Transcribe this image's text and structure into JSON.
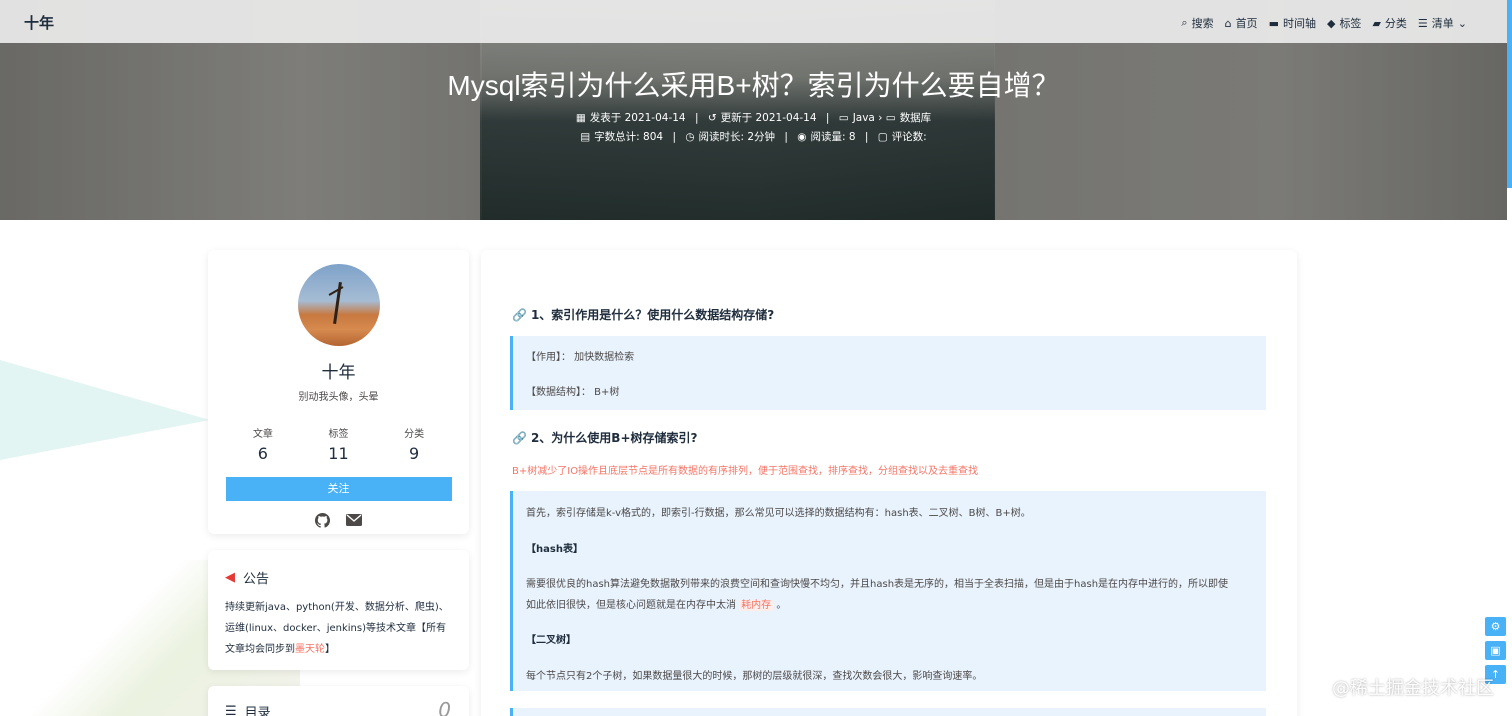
{
  "nav": {
    "site_name": "十年",
    "items": [
      {
        "label": "搜索",
        "icon": "search-icon"
      },
      {
        "label": "首页",
        "icon": "home-icon"
      },
      {
        "label": "时间轴",
        "icon": "archive-icon"
      },
      {
        "label": "标签",
        "icon": "tags-icon"
      },
      {
        "label": "分类",
        "icon": "folder-icon"
      },
      {
        "label": "清单",
        "icon": "list-icon"
      }
    ]
  },
  "post": {
    "title": "Mysql索引为什么采用B+树？索引为什么要自增？",
    "published_label": "发表于",
    "published": "2021-04-14",
    "updated_label": "更新于",
    "updated": "2021-04-14",
    "category1": "Java",
    "category2": "数据库",
    "wordcount": "字数总计: 804",
    "readtime": "阅读时长: 2分钟",
    "views": "阅读量: 8",
    "comments": "评论数:"
  },
  "profile": {
    "name": "十年",
    "motto": "别动我头像，头晕",
    "stats": [
      {
        "label": "文章",
        "value": "6"
      },
      {
        "label": "标签",
        "value": "11"
      },
      {
        "label": "分类",
        "value": "9"
      }
    ],
    "follow_label": "关注"
  },
  "notice": {
    "title": "公告",
    "text_before": "持续更新java、python(开发、数据分析、爬虫)、运维(linux、docker、jenkins)等技术文章【所有文章均会同步到",
    "link": "墨天轮",
    "text_after": "】"
  },
  "toc": {
    "title": "目录",
    "count": "0"
  },
  "article": {
    "h1": "1、索引作用是什么？使用什么数据结构存储?",
    "q1_line1": "【作用】： 加快数据检索",
    "q1_line2": "【数据结构】： B+树",
    "h2": "2、为什么使用B+树存储索引?",
    "red_line": "B+树减少了IO操作且底层节点是所有数据的有序排列，便于范围查找，排序查找，分组查找以及去重查找",
    "q2_p1": "首先，索引存储是k-v格式的，即索引-行数据，那么常见可以选择的数据结构有：hash表、二叉树、B树、B+树。",
    "q2_h_hash": "【hash表】",
    "q2_p2a": "需要很优良的hash算法避免数据散列带来的浪费空间和查询快慢不均匀，并且hash表是无序的，相当于全表扫描，但是由于hash是在内存中进行的，所以即使",
    "q2_p2b": "如此依旧很快，但是核心问题就是在内存中太消",
    "q2_mark": "耗内存",
    "q2_p2c": "。",
    "q2_h_bin": "【二叉树】",
    "q2_p3": "每个节点只有2个子树，如果数据量很大的时候，那树的层级就很深，查找次数会很大，影响查询速率。"
  },
  "watermark": "@稀土掘金技术社区"
}
